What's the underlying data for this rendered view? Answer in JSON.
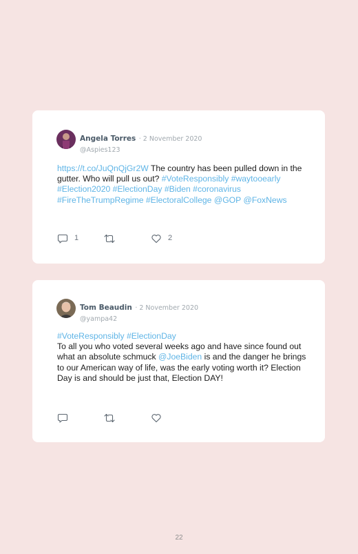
{
  "tweets": [
    {
      "author": "Angela Torres",
      "date": "· 2 November 2020",
      "handle": "@Aspies123",
      "segments": [
        {
          "text": "https://t.co/JuQnQjGr2W",
          "link": true
        },
        {
          "text": " The country has been pulled down in the gutter. Who will pull us out? ",
          "link": false
        },
        {
          "text": "#VoteResponsibly #waytooearly #Election2020 #ElectionDay #Biden #coronavirus #FireTheTrumpRegime #ElectoralCollege @GOP @FoxNews",
          "link": true
        }
      ],
      "reply_count": "1",
      "like_count": "2"
    },
    {
      "author": "Tom Beaudin",
      "date": "· 2 November 2020",
      "handle": "@yampa42",
      "segments": [
        {
          "text": "#VoteResponsibly #ElectionDay",
          "link": true
        },
        {
          "text": " To all you who voted several weeks ago and have since found out what an absolute schmuck ",
          "link": false
        },
        {
          "text": "@JoeBiden",
          "link": true
        },
        {
          "text": " is and the danger he brings to our American way of life, was the early voting worth it? Election Day is and should be just that, Election DAY!",
          "link": false
        }
      ],
      "reply_count": "",
      "like_count": ""
    }
  ],
  "page_number": "22",
  "colors": {
    "background": "#f6e4e3",
    "link": "#5eb4e6",
    "name": "#4a5a68",
    "muted": "#a0a8ae"
  },
  "icons": [
    "reply-icon",
    "retweet-icon",
    "like-icon"
  ]
}
